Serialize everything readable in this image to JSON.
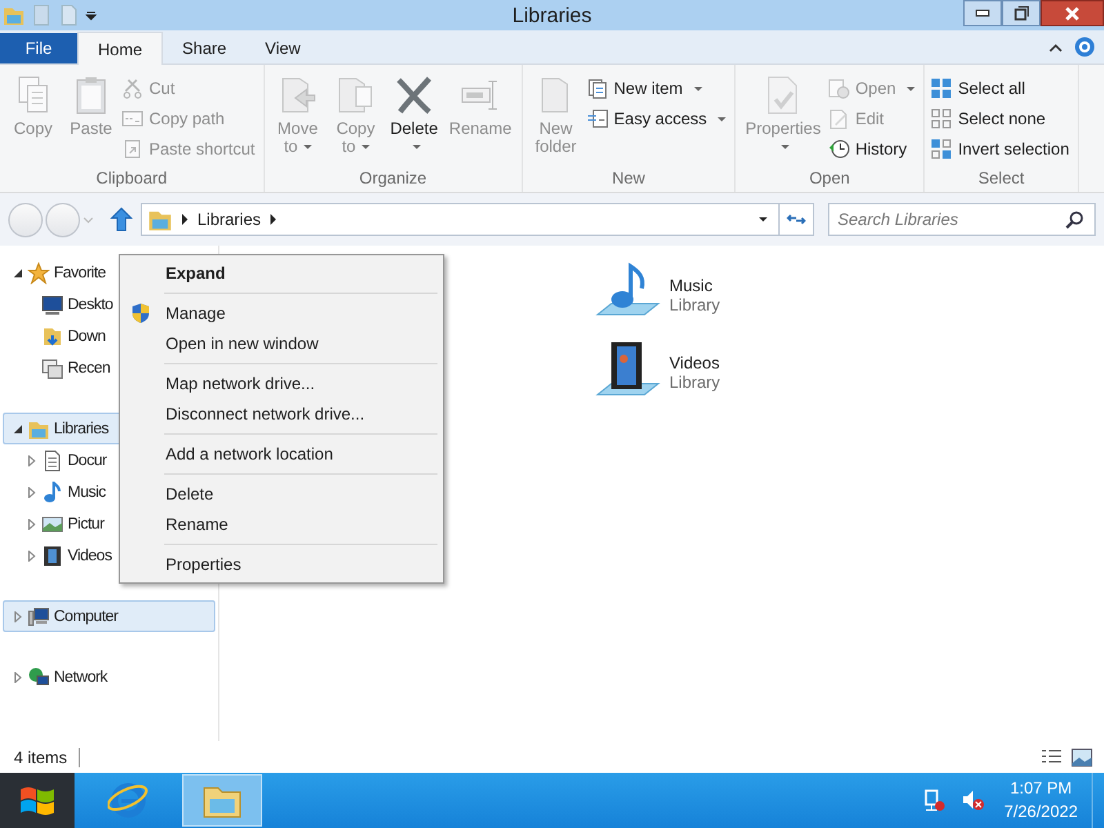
{
  "window": {
    "title": "Libraries"
  },
  "ribbon_tabs": [
    {
      "label": "File",
      "selected": false,
      "kind": "file"
    },
    {
      "label": "Home",
      "selected": true,
      "kind": "tab"
    },
    {
      "label": "Share",
      "selected": false,
      "kind": "tab"
    },
    {
      "label": "View",
      "selected": false,
      "kind": "tab"
    }
  ],
  "ribbon_groups": [
    {
      "label": "Clipboard",
      "items": [
        {
          "kind": "large",
          "label": "Copy",
          "disabled": true,
          "dropdown": false
        },
        {
          "kind": "large",
          "label": "Paste",
          "disabled": true,
          "dropdown": false
        },
        {
          "kind": "stack",
          "commands": [
            {
              "label": "Cut",
              "disabled": true,
              "dropdown": false
            },
            {
              "label": "Copy path",
              "disabled": true,
              "dropdown": false
            },
            {
              "label": "Paste shortcut",
              "disabled": true,
              "dropdown": false
            }
          ]
        }
      ]
    },
    {
      "label": "Organize",
      "items": [
        {
          "kind": "large",
          "label": "Move to",
          "disabled": true,
          "dropdown": true
        },
        {
          "kind": "large",
          "label": "Copy to",
          "disabled": true,
          "dropdown": true
        },
        {
          "kind": "large",
          "label": "Delete",
          "disabled": false,
          "dropdown": true
        },
        {
          "kind": "large",
          "label": "Rename",
          "disabled": true,
          "dropdown": false
        }
      ]
    },
    {
      "label": "New",
      "items": [
        {
          "kind": "large",
          "label": "New folder",
          "disabled": true,
          "dropdown": false
        },
        {
          "kind": "stack",
          "commands": [
            {
              "label": "New item",
              "disabled": false,
              "dropdown": true
            },
            {
              "label": "Easy access",
              "disabled": false,
              "dropdown": true
            }
          ]
        }
      ]
    },
    {
      "label": "Open",
      "items": [
        {
          "kind": "large",
          "label": "Properties",
          "disabled": true,
          "dropdown": true
        },
        {
          "kind": "stack",
          "commands": [
            {
              "label": "Open",
              "disabled": true,
              "dropdown": true
            },
            {
              "label": "Edit",
              "disabled": true,
              "dropdown": false
            },
            {
              "label": "History",
              "disabled": false,
              "dropdown": false
            }
          ]
        }
      ]
    },
    {
      "label": "Select",
      "items": [
        {
          "kind": "stack",
          "commands": [
            {
              "label": "Select all",
              "disabled": false,
              "dropdown": false
            },
            {
              "label": "Select none",
              "disabled": false,
              "dropdown": false
            },
            {
              "label": "Invert selection",
              "disabled": false,
              "dropdown": false
            }
          ]
        }
      ]
    }
  ],
  "address_bar": {
    "path": [
      "Libraries"
    ]
  },
  "search": {
    "placeholder": "Search Libraries"
  },
  "navigation": [
    {
      "label": "Favorite",
      "expanded": true,
      "selected": false,
      "children": [
        {
          "label": "Deskto",
          "selected": false
        },
        {
          "label": "Down",
          "selected": false
        },
        {
          "label": "Recen",
          "selected": false
        }
      ]
    },
    {
      "label": "Libraries",
      "expanded": true,
      "selected": true,
      "children": [
        {
          "label": "Docur",
          "expanded": false,
          "selected": false
        },
        {
          "label": "Music",
          "expanded": false,
          "selected": false
        },
        {
          "label": "Pictur",
          "expanded": false,
          "selected": false
        },
        {
          "label": "Videos",
          "expanded": false,
          "selected": false
        }
      ]
    },
    {
      "label": "Computer",
      "expanded": false,
      "selected": true
    },
    {
      "label": "Network",
      "expanded": false,
      "selected": false
    }
  ],
  "items": [
    {
      "name": "Music",
      "type": "Library"
    },
    {
      "name": "Videos",
      "type": "Library"
    }
  ],
  "context_menu": [
    [
      {
        "label": "Expand",
        "default": true
      }
    ],
    [
      {
        "label": "Manage",
        "default": false,
        "shield": true
      },
      {
        "label": "Open in new window",
        "default": false
      }
    ],
    [
      {
        "label": "Map network drive...",
        "default": false
      },
      {
        "label": "Disconnect network drive...",
        "default": false
      }
    ],
    [
      {
        "label": "Add a network location",
        "default": false
      }
    ],
    [
      {
        "label": "Delete",
        "default": false
      },
      {
        "label": "Rename",
        "default": false
      }
    ],
    [
      {
        "label": "Properties",
        "default": false
      }
    ]
  ],
  "status_bar": {
    "count": "4 items"
  },
  "taskbar": {
    "apps": [
      {
        "selected": false
      },
      {
        "selected": true
      }
    ],
    "time": "1:07 PM",
    "date": "7/26/2022"
  }
}
